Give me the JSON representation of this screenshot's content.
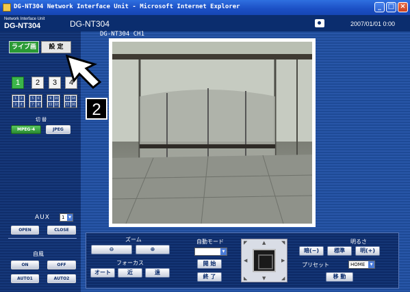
{
  "window": {
    "title": "DG-NT304 Network Interface Unit - Microsoft Internet Explorer",
    "minimize": "_",
    "maximize": "□",
    "close": "×"
  },
  "header": {
    "brand_sub": "Network Interface Unit",
    "brand_main": "DG-NT304",
    "model": "DG-NT304",
    "datetime": "2007/01/01  0:00"
  },
  "tabs": {
    "live": "ライブ画",
    "setup": "設 定"
  },
  "camera_buttons": [
    "1",
    "2",
    "3",
    "4"
  ],
  "quad_buttons": [
    [
      "1",
      "2",
      "3",
      "4"
    ],
    [
      "5",
      "6",
      "7",
      "8"
    ],
    [
      "9",
      "10",
      "11",
      "12"
    ],
    [
      "13",
      "14",
      "15",
      "16"
    ]
  ],
  "switch": {
    "label": "切 替",
    "mpeg4": "MPEG-4",
    "jpeg": "JPEG"
  },
  "aux": {
    "label": "AUX",
    "value": "1",
    "open": "OPEN",
    "close": "CLOSE"
  },
  "fan": {
    "label": "自風",
    "on": "ON",
    "off": "OFF",
    "auto1": "AUTO1",
    "auto2": "AUTO2"
  },
  "viewer": {
    "camera_title": "DG-NT304 CH1"
  },
  "controls": {
    "zoom_label": "ズーム",
    "focus_label": "フォーカス",
    "focus_auto": "オート",
    "focus_near": "近",
    "focus_far": "遠",
    "auto_mode_label": "自動モード",
    "start": "開 始",
    "end": "終 了",
    "brightness_label": "明るさ",
    "dark": "暗(−)",
    "standard": "標準",
    "bright": "明(+)",
    "preset_label": "プリセット",
    "preset_value": "HOME",
    "move": "移 動"
  },
  "annotation": {
    "step_number": "2"
  },
  "colors": {
    "header_bg": "#0b2d6e",
    "live_tab": "#2a9a35",
    "active_button": "#3bb54a"
  }
}
